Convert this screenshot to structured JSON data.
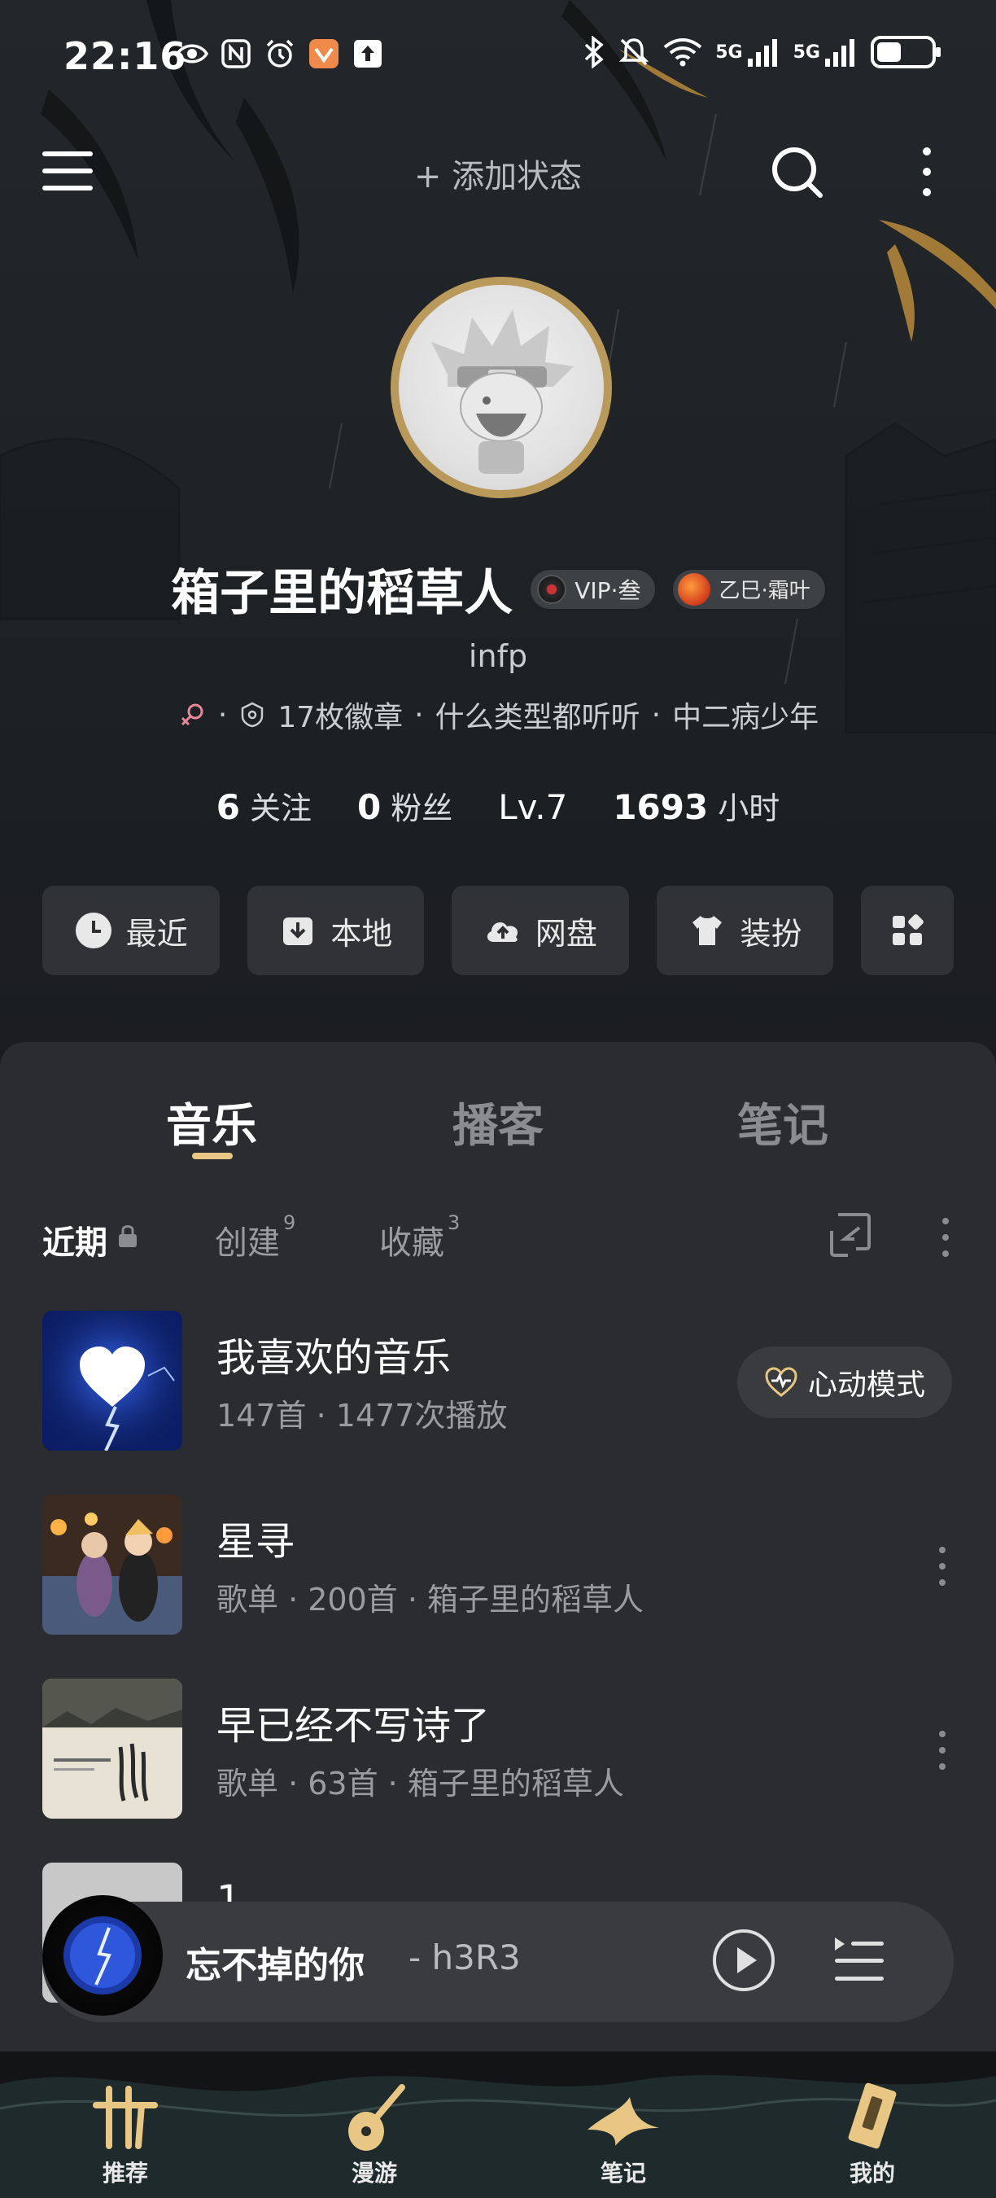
{
  "status_bar": {
    "time": "22:16",
    "network_1": "5G",
    "network_2": "5G",
    "battery_percent": 45
  },
  "top_bar": {
    "add_status": "+ 添加状态"
  },
  "profile": {
    "username": "箱子里的稻草人",
    "vip_label": "VIP·叁",
    "year_label": "乙巳·霜叶",
    "bio": "infp",
    "badges": "17枚徽章",
    "tag_1": "什么类型都听听",
    "tag_2": "中二病少年",
    "following_count": "6",
    "following_label": "关注",
    "followers_count": "0",
    "followers_label": "粉丝",
    "level": "Lv.7",
    "hours_count": "1693",
    "hours_label": "小时"
  },
  "quick_actions": {
    "recent": "最近",
    "local": "本地",
    "cloud": "网盘",
    "dress": "装扮"
  },
  "main_tabs": {
    "music": "音乐",
    "podcast": "播客",
    "notes": "笔记"
  },
  "sub_tabs": {
    "recent": "近期",
    "created": "创建",
    "created_count": "9",
    "collected": "收藏",
    "collected_count": "3"
  },
  "playlists": [
    {
      "title": "我喜欢的音乐",
      "subtitle": "147首 · 1477次播放",
      "action": "心动模式"
    },
    {
      "title": "星寻",
      "subtitle": "歌单 · 200首 · 箱子里的稻草人"
    },
    {
      "title": "早已经不写诗了",
      "subtitle": "歌单 · 63首 · 箱子里的稻草人"
    },
    {
      "title": "1"
    }
  ],
  "player": {
    "song": "忘不掉的你",
    "artist": "- h3R3"
  },
  "bottom_nav": {
    "recommend": "推荐",
    "roam": "漫游",
    "notes": "笔记",
    "mine": "我的"
  },
  "colors": {
    "accent_gold": "#e8c784",
    "panel": "#2b2c2f",
    "background": "#1b1c1f"
  }
}
